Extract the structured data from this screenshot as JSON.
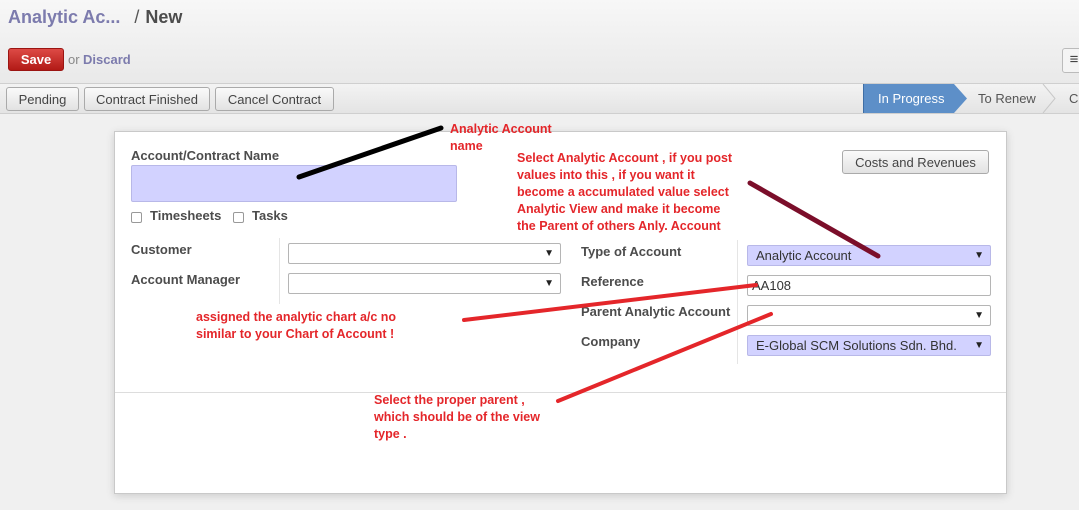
{
  "header": {
    "breadcrumb_parent": "Analytic Ac...",
    "breadcrumb_separator": "/",
    "breadcrumb_current": "New",
    "save_label": "Save",
    "or_label": "or",
    "discard_label": "Discard",
    "menu_icon": "hamburger-menu-icon"
  },
  "statusbar": {
    "buttons": [
      "Pending",
      "Contract Finished",
      "Cancel Contract"
    ],
    "stages": [
      {
        "label": "In Progress",
        "active": true
      },
      {
        "label": "To Renew",
        "active": false
      },
      {
        "label": "Cl",
        "active": false
      }
    ]
  },
  "form": {
    "name_label": "Account/Contract Name",
    "name_value": "",
    "timesheets_label": "Timesheets",
    "timesheets_checked": false,
    "tasks_label": "Tasks",
    "tasks_checked": false,
    "customer_label": "Customer",
    "customer_value": "",
    "manager_label": "Account Manager",
    "manager_value": "",
    "type_label": "Type of Account",
    "type_value": "Analytic Account",
    "reference_label": "Reference",
    "reference_value": "AA108",
    "parent_label": "Parent Analytic Account",
    "parent_value": "",
    "company_label": "Company",
    "company_value": "E-Global SCM Solutions Sdn. Bhd.",
    "costs_button": "Costs and Revenues"
  },
  "annotations": {
    "name_note": [
      "Analytic Account",
      "name"
    ],
    "type_note": [
      "Select Analytic Account , if you post",
      "values into this , if you want it",
      "become a accumulated value select",
      "Analytic View and make it become",
      "the Parent of others Anly. Account"
    ],
    "reference_note": [
      "assigned the analytic chart a/c no",
      "similar to your Chart of Account !"
    ],
    "parent_note": [
      "Select the proper parent ,",
      "which should be of the view",
      "type ."
    ]
  },
  "colors": {
    "accent": "#7c7bad",
    "save": "#c9302c",
    "stage_active": "#5d8fc8",
    "required_field": "#d2d2ff",
    "annotation": "#e4262a",
    "arrow_dark": "#7b0e2a"
  }
}
